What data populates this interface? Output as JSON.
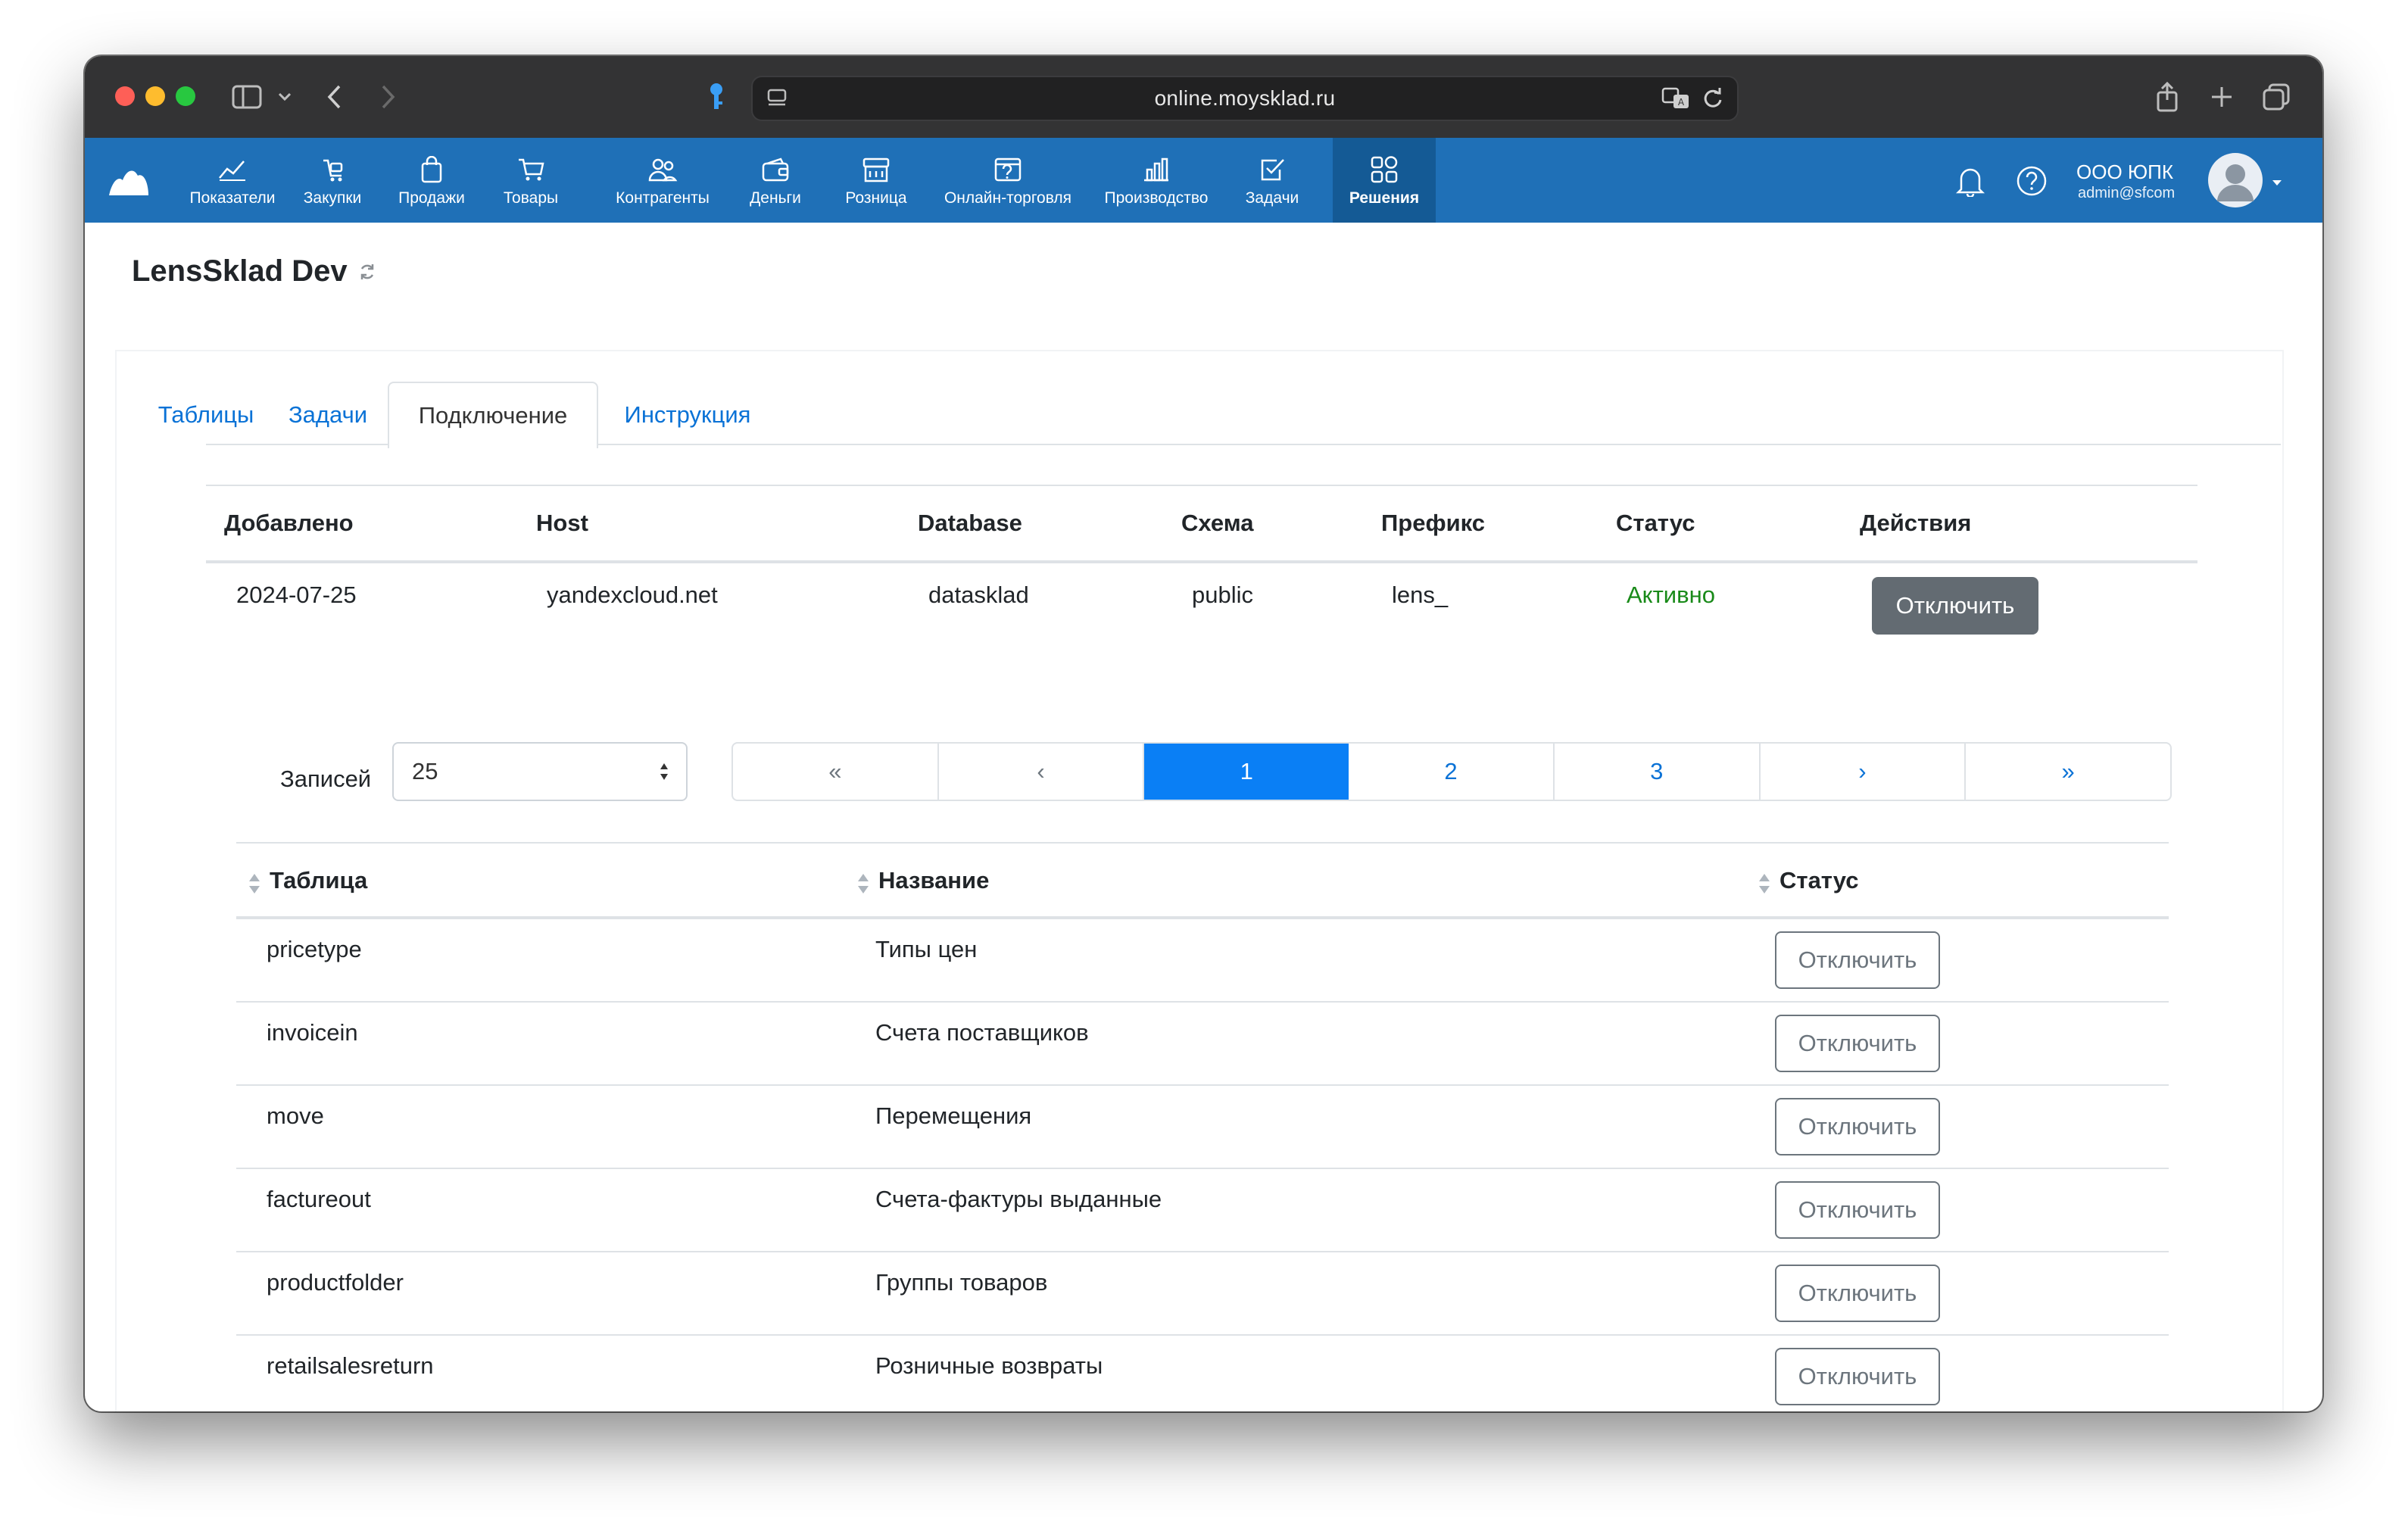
{
  "browser": {
    "url": "online.moysklad.ru"
  },
  "nav": {
    "items": [
      {
        "label": "Показатели",
        "icon": "chart-line-icon"
      },
      {
        "label": "Закупки",
        "icon": "purchase-icon"
      },
      {
        "label": "Продажи",
        "icon": "bag-icon"
      },
      {
        "label": "Товары",
        "icon": "cart-icon"
      },
      {
        "label": "Контрагенты",
        "icon": "people-icon"
      },
      {
        "label": "Деньги",
        "icon": "wallet-icon"
      },
      {
        "label": "Розница",
        "icon": "store-icon"
      },
      {
        "label": "Онлайн-торговля",
        "icon": "online-store-icon"
      },
      {
        "label": "Производство",
        "icon": "factory-icon"
      },
      {
        "label": "Задачи",
        "icon": "checkbox-icon"
      },
      {
        "label": "Решения",
        "icon": "apps-grid-icon"
      }
    ],
    "active": "Решения",
    "user": {
      "name": "ООО ЮПК",
      "email": "admin@sfcom"
    }
  },
  "page": {
    "title": "LensSklad Dev"
  },
  "tabs": [
    {
      "label": "Таблицы"
    },
    {
      "label": "Задачи"
    },
    {
      "label": "Подключение"
    },
    {
      "label": "Инструкция"
    }
  ],
  "connection": {
    "headers": [
      "Добавлено",
      "Host",
      "Database",
      "Схема",
      "Префикс",
      "Статус",
      "Действия"
    ],
    "row": {
      "added": "2024-07-25",
      "host": "yandexcloud.net",
      "database": "datasklad",
      "schema": "public",
      "prefix": "lens_",
      "status": "Активно",
      "action": "Отключить"
    }
  },
  "pagination": {
    "records_label": "Записей",
    "per_page": "25",
    "pages": [
      "«",
      "‹",
      "1",
      "2",
      "3",
      "›",
      "»"
    ],
    "current": "1"
  },
  "tables": {
    "headers": [
      "Таблица",
      "Название",
      "Статус"
    ],
    "rows": [
      {
        "table": "pricetype",
        "name": "Типы цен",
        "action": "Отключить"
      },
      {
        "table": "invoicein",
        "name": "Счета поставщиков",
        "action": "Отключить"
      },
      {
        "table": "move",
        "name": "Перемещения",
        "action": "Отключить"
      },
      {
        "table": "factureout",
        "name": "Счета-фактуры выданные",
        "action": "Отключить"
      },
      {
        "table": "productfolder",
        "name": "Группы товаров",
        "action": "Отключить"
      },
      {
        "table": "retailsalesreturn",
        "name": "Розничные возвраты",
        "action": "Отключить"
      }
    ]
  },
  "colors": {
    "nav_bg": "#1f70b7",
    "nav_active": "#145a95",
    "link": "#0a72d6",
    "active_status": "#198a19",
    "page_active": "#0a7ff5"
  }
}
